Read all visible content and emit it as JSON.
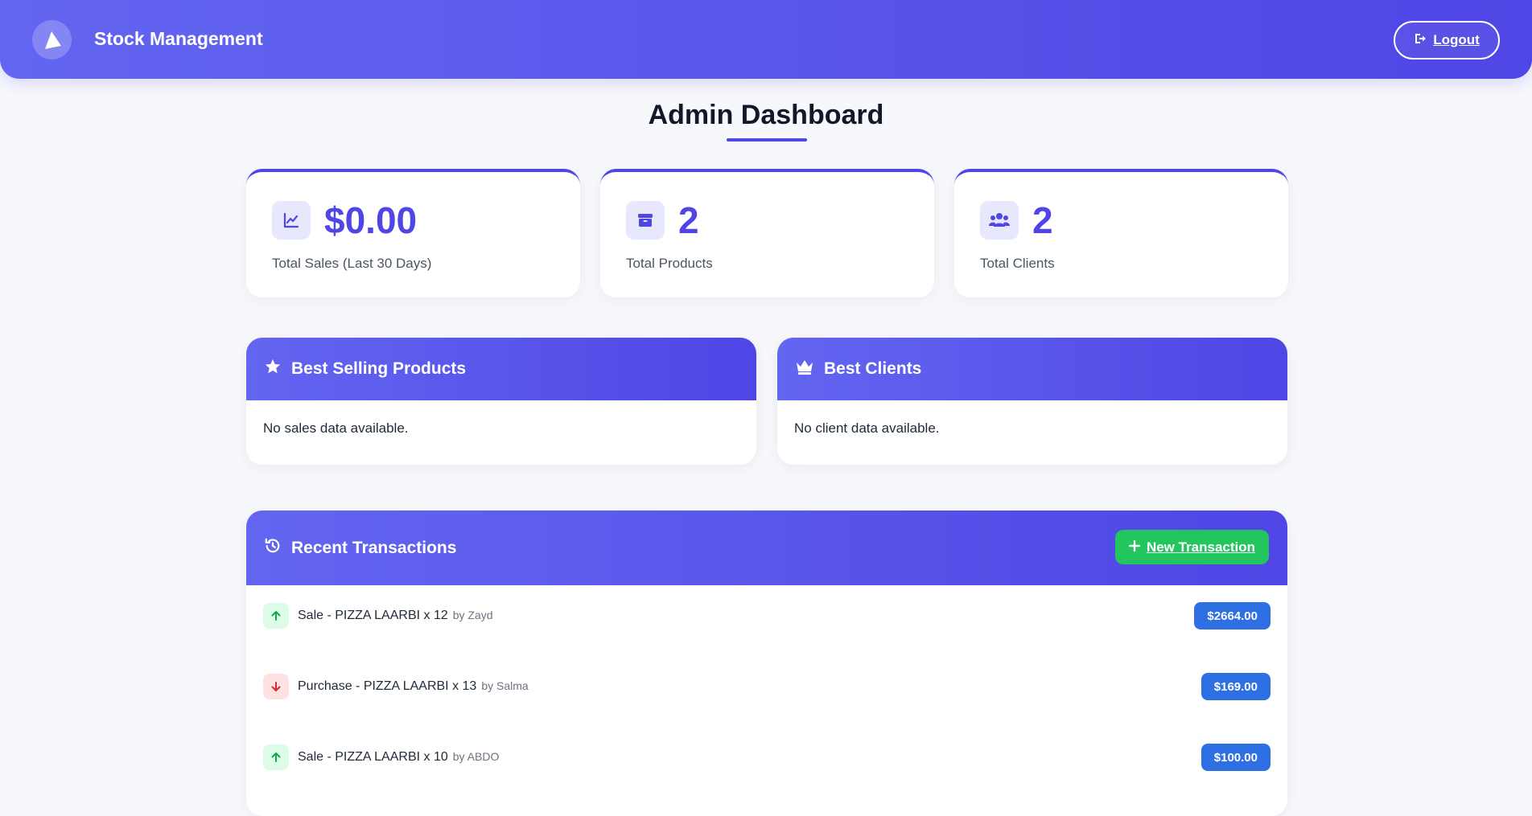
{
  "app": {
    "title": "Stock Management",
    "logout_label": "Logout"
  },
  "page": {
    "title": "Admin Dashboard"
  },
  "stats": [
    {
      "value": "$0.00",
      "label": "Total Sales (Last 30 Days)",
      "icon": "chart-line-icon"
    },
    {
      "value": "2",
      "label": "Total Products",
      "icon": "box-icon"
    },
    {
      "value": "2",
      "label": "Total Clients",
      "icon": "users-icon"
    }
  ],
  "best_selling": {
    "title": "Best Selling Products",
    "empty_text": "No sales data available.",
    "icon": "star-icon"
  },
  "best_clients": {
    "title": "Best Clients",
    "empty_text": "No client data available.",
    "icon": "crown-icon"
  },
  "transactions": {
    "title": "Recent Transactions",
    "icon": "history-icon",
    "new_button_label": "New Transaction",
    "rows": [
      {
        "direction": "up",
        "text": "Sale - PIZZA LAARBI x 12",
        "by": "by Zayd",
        "amount": "$2664.00"
      },
      {
        "direction": "down",
        "text": "Purchase - PIZZA LAARBI x 13",
        "by": "by Salma",
        "amount": "$169.00"
      },
      {
        "direction": "up",
        "text": "Sale - PIZZA LAARBI x 10",
        "by": "by ABDO",
        "amount": "$100.00"
      }
    ]
  },
  "colors": {
    "primary": "#4f46e5",
    "primary_light": "#6366f1",
    "success": "#22c55e",
    "amount_badge": "#2f6fe4",
    "up_arrow": "#16a34a",
    "down_arrow": "#dc2626"
  }
}
